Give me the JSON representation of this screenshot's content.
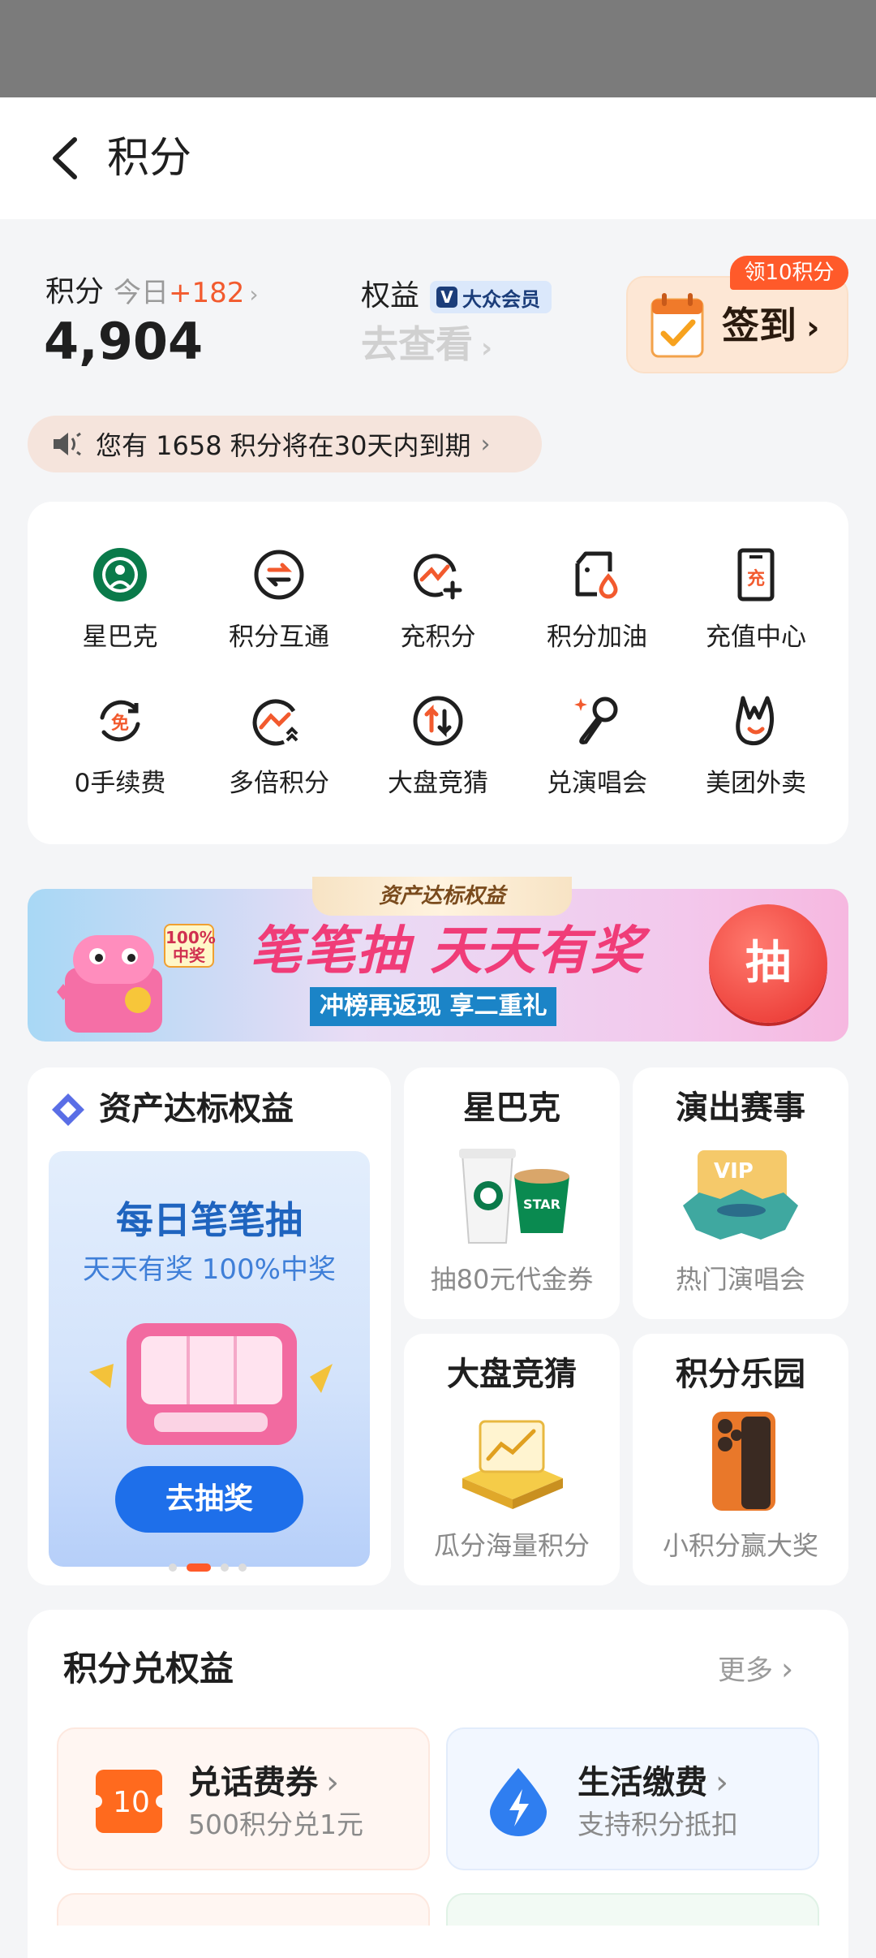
{
  "nav": {
    "title": "积分"
  },
  "summary": {
    "points_label": "积分",
    "today_label": "今日",
    "today_delta": "+182",
    "points_value": "4,904",
    "rights_label": "权益",
    "member_badge": "大众会员",
    "rights_link": "去查看",
    "checkin_tag": "领10积分",
    "checkin_label": "签到"
  },
  "expire_notice": "您有 1658 积分将在30天内到期",
  "grid": [
    {
      "label": "星巴克",
      "icon": "starbucks-icon"
    },
    {
      "label": "积分互通",
      "icon": "exchange-icon"
    },
    {
      "label": "充积分",
      "icon": "add-points-icon"
    },
    {
      "label": "积分加油",
      "icon": "fuel-icon"
    },
    {
      "label": "充值中心",
      "icon": "recharge-icon"
    },
    {
      "label": "0手续费",
      "icon": "free-fee-icon"
    },
    {
      "label": "多倍积分",
      "icon": "multi-points-icon"
    },
    {
      "label": "大盘竞猜",
      "icon": "market-guess-icon"
    },
    {
      "label": "兑演唱会",
      "icon": "concert-icon"
    },
    {
      "label": "美团外卖",
      "icon": "meituan-icon"
    }
  ],
  "banner": {
    "tag": "资产达标权益",
    "title": "笔笔抽 天天有奖",
    "subtitle": "冲榜再返现 享二重礼",
    "button": "抽",
    "badge": "100%中奖"
  },
  "asset_card": {
    "title": "资产达标权益",
    "inner_title": "每日笔笔抽",
    "inner_sub": "天天有奖 100%中奖",
    "button": "去抽奖",
    "page_count": 4,
    "active_page": 2
  },
  "tiles": [
    {
      "title": "星巴克",
      "sub": "抽80元代金券",
      "icon": "coffee-cups-icon"
    },
    {
      "title": "演出赛事",
      "sub": "热门演唱会",
      "icon": "vip-ticket-icon"
    },
    {
      "title": "大盘竞猜",
      "sub": "瓜分海量积分",
      "icon": "gold-chart-icon"
    },
    {
      "title": "积分乐园",
      "sub": "小积分赢大奖",
      "icon": "phone-prize-icon"
    }
  ],
  "exchange": {
    "title": "积分兑权益",
    "more": "更多",
    "items": [
      {
        "title": "兑话费券",
        "sub": "500积分兑1元",
        "icon": "phone-voucher-icon",
        "icon_text": "10"
      },
      {
        "title": "生活缴费",
        "sub": "支持积分抵扣",
        "icon": "lightning-drop-icon"
      }
    ]
  },
  "colors": {
    "accent": "#ff5a2a",
    "blue": "#1e6fea",
    "background": "#f4f5f7"
  }
}
